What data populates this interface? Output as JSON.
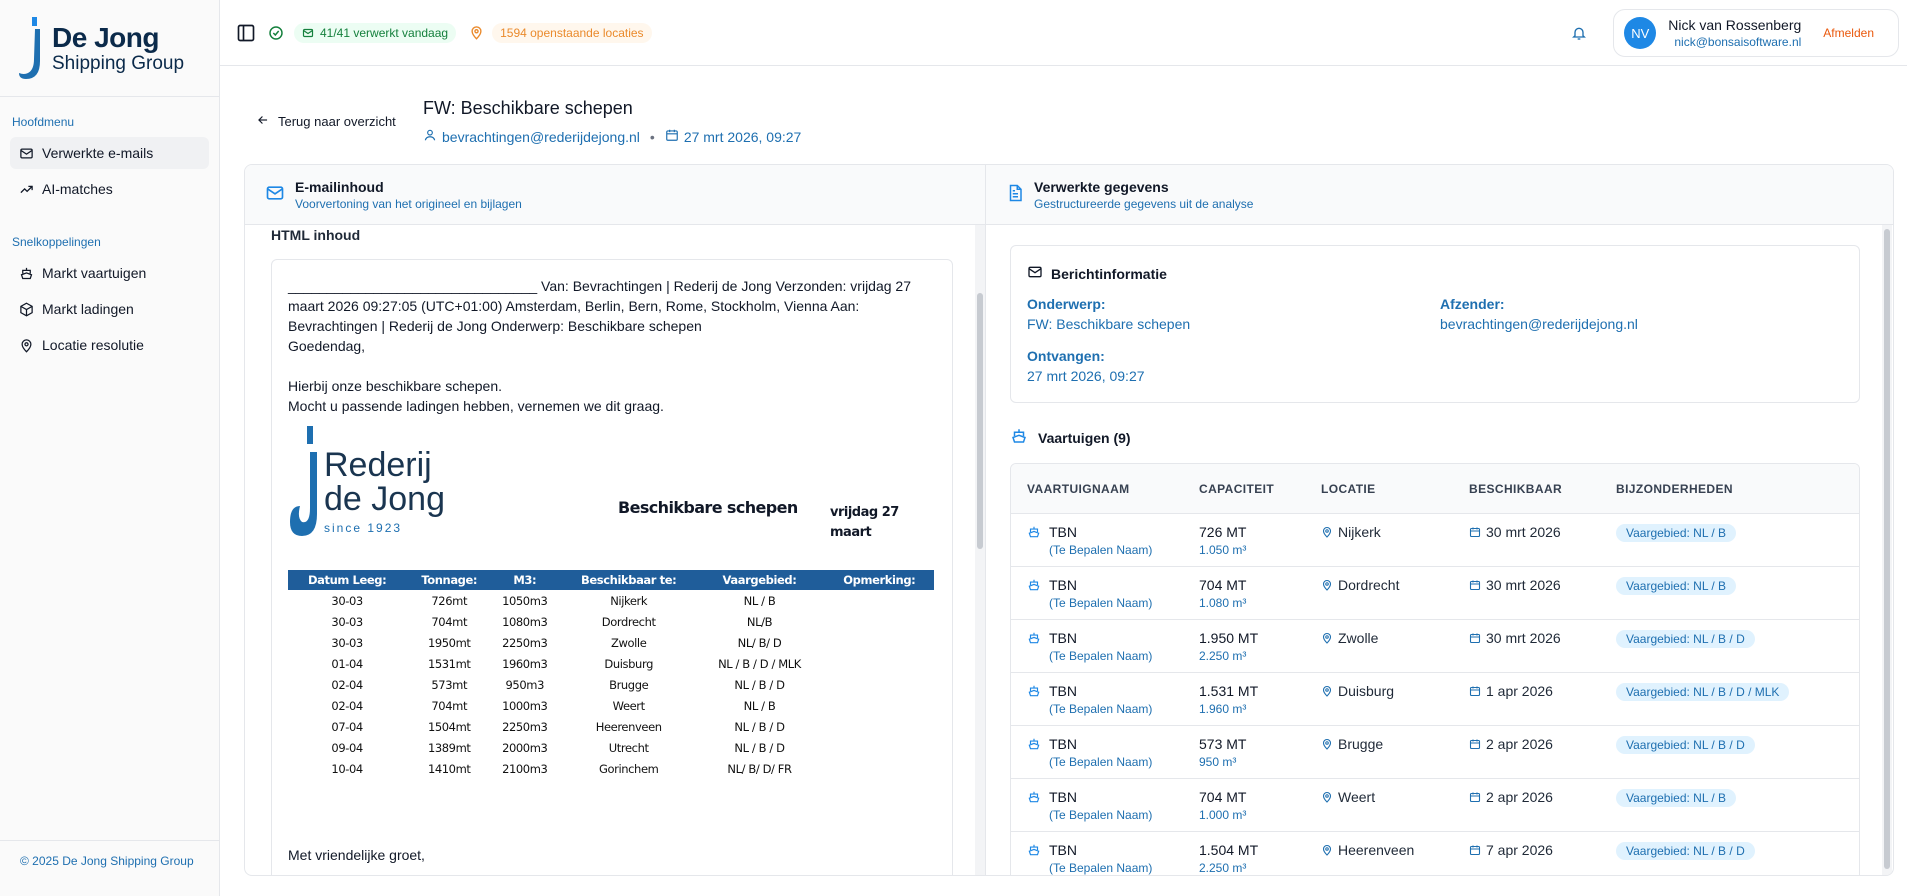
{
  "brand": {
    "line1": "De Jong",
    "line2": "Shipping Group"
  },
  "sidebar": {
    "main_heading": "Hoofdmenu",
    "main_items": [
      {
        "label": "Verwerkte e-mails",
        "icon": "mail-icon",
        "active": true
      },
      {
        "label": "AI-matches",
        "icon": "trending-up-icon",
        "active": false
      }
    ],
    "shortcuts_heading": "Snelkoppelingen",
    "shortcut_items": [
      {
        "label": "Markt vaartuigen",
        "icon": "ship-icon"
      },
      {
        "label": "Markt ladingen",
        "icon": "package-icon"
      },
      {
        "label": "Locatie resolutie",
        "icon": "map-pin-icon"
      }
    ],
    "footer": "© 2025 De Jong Shipping Group"
  },
  "header": {
    "processed_today": "41/41 verwerkt vandaag",
    "open_locations": "1594 openstaande locaties",
    "user": {
      "initials": "NV",
      "name": "Nick van Rossenberg",
      "email": "nick@bonsaisoftware.nl",
      "logout": "Afmelden"
    }
  },
  "mail": {
    "back": "Terug naar overzicht",
    "title": "FW: Beschikbare schepen",
    "sender": "bevrachtingen@rederijdejong.nl",
    "date": "27 mrt 2026, 09:27"
  },
  "left_panel": {
    "title": "E-mailinhoud",
    "subtitle": "Voorvertoning van het origineel en bijlagen",
    "html_label": "HTML inhoud",
    "body": {
      "header_line": "________________________________ Van: Bevrachtingen | Rederij de Jong Verzonden: vrijdag 27 maart 2026 09:27:05 (UTC+01:00) Amsterdam, Berlin, Bern, Rome, Stockholm, Vienna Aan: Bevrachtingen | Rederij de Jong Onderwerp: Beschikbare schepen",
      "greeting": "Goedendag,",
      "p1": "Hierbij onze beschikbare schepen.",
      "p2": "Mocht u passende ladingen hebben, vernemen we dit graag.",
      "logo_line1": "Rederij",
      "logo_line2": "de Jong",
      "logo_line3": "since 1923",
      "sheet_title": "Beschikbare schepen",
      "sheet_date": "vrijdag 27 maart",
      "table_headers": [
        "Datum Leeg:",
        "Tonnage:",
        "M3:",
        "Beschikbaar te:",
        "Vaargebied:",
        "",
        "Opmerking:"
      ],
      "table_rows": [
        [
          "30-03",
          "726mt",
          "1050m3",
          "Nijkerk",
          "NL / B",
          "",
          ""
        ],
        [
          "30-03",
          "704mt",
          "1080m3",
          "Dordrecht",
          "NL/B",
          "",
          ""
        ],
        [
          "30-03",
          "1950mt",
          "2250m3",
          "Zwolle",
          "NL/ B/ D",
          "",
          ""
        ],
        [
          "01-04",
          "1531mt",
          "1960m3",
          "Duisburg",
          "NL / B / D / MLK",
          "",
          ""
        ],
        [
          "02-04",
          "573mt",
          "950m3",
          "Brugge",
          "NL / B / D",
          "",
          ""
        ],
        [
          "02-04",
          "704mt",
          "1000m3",
          "Weert",
          "NL / B",
          "",
          ""
        ],
        [
          "07-04",
          "1504mt",
          "2250m3",
          "Heerenveen",
          "NL / B / D",
          "",
          ""
        ],
        [
          "09-04",
          "1389mt",
          "2000m3",
          "Utrecht",
          "NL / B / D",
          "",
          ""
        ],
        [
          "10-04",
          "1410mt",
          "2100m3",
          "Gorinchem",
          "NL/ B/ D/ FR",
          "",
          ""
        ]
      ],
      "closing": "Met vriendelijke groet,"
    }
  },
  "right_panel": {
    "title": "Verwerkte gegevens",
    "subtitle": "Gestructureerde gegevens uit de analyse",
    "info": {
      "heading": "Berichtinformatie",
      "subject_label": "Onderwerp:",
      "subject": "FW: Beschikbare schepen",
      "sender_label": "Afzender:",
      "sender": "bevrachtingen@rederijdejong.nl",
      "received_label": "Ontvangen:",
      "received": "27 mrt 2026, 09:27"
    },
    "vessels_heading": "Vaartuigen (9)",
    "columns": [
      "VAARTUIGNAAM",
      "CAPACITEIT",
      "LOCATIE",
      "BESCHIKBAAR",
      "BIJZONDERHEDEN"
    ],
    "vessels": [
      {
        "name": "TBN",
        "sub": "(Te Bepalen Naam)",
        "capacity": "726 MT",
        "volume": "1.050 m³",
        "location": "Nijkerk",
        "available": "30 mrt 2026",
        "badge": "Vaargebied: NL / B"
      },
      {
        "name": "TBN",
        "sub": "(Te Bepalen Naam)",
        "capacity": "704 MT",
        "volume": "1.080 m³",
        "location": "Dordrecht",
        "available": "30 mrt 2026",
        "badge": "Vaargebied: NL / B"
      },
      {
        "name": "TBN",
        "sub": "(Te Bepalen Naam)",
        "capacity": "1.950 MT",
        "volume": "2.250 m³",
        "location": "Zwolle",
        "available": "30 mrt 2026",
        "badge": "Vaargebied: NL / B / D"
      },
      {
        "name": "TBN",
        "sub": "(Te Bepalen Naam)",
        "capacity": "1.531 MT",
        "volume": "1.960 m³",
        "location": "Duisburg",
        "available": "1 apr 2026",
        "badge": "Vaargebied: NL / B / D / MLK"
      },
      {
        "name": "TBN",
        "sub": "(Te Bepalen Naam)",
        "capacity": "573 MT",
        "volume": "950 m³",
        "location": "Brugge",
        "available": "2 apr 2026",
        "badge": "Vaargebied: NL / B / D"
      },
      {
        "name": "TBN",
        "sub": "(Te Bepalen Naam)",
        "capacity": "704 MT",
        "volume": "1.000 m³",
        "location": "Weert",
        "available": "2 apr 2026",
        "badge": "Vaargebied: NL / B"
      },
      {
        "name": "TBN",
        "sub": "(Te Bepalen Naam)",
        "capacity": "1.504 MT",
        "volume": "2.250 m³",
        "location": "Heerenveen",
        "available": "7 apr 2026",
        "badge": "Vaargebied: NL / B / D"
      }
    ]
  },
  "colors": {
    "accent": "#1e6fb0",
    "logout": "#ea580c",
    "success": "#15803d",
    "warning": "#ea8a2c",
    "table_header": "#1f5d9a"
  }
}
